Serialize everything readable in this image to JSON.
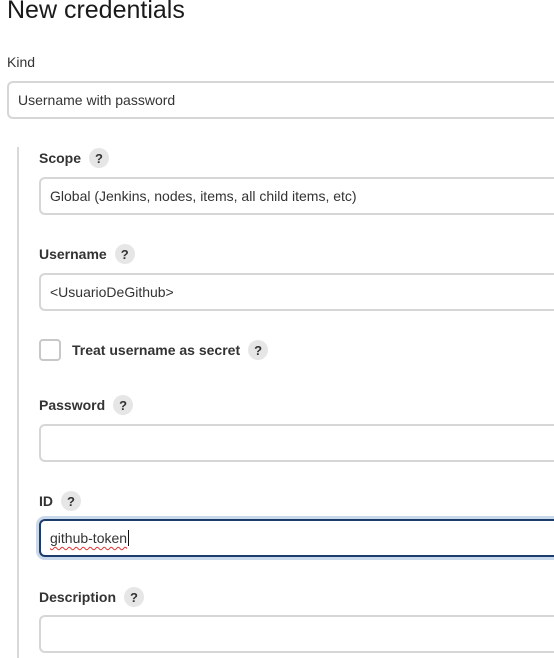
{
  "page": {
    "title": "New credentials"
  },
  "kind": {
    "label": "Kind",
    "value": "Username with password"
  },
  "scope": {
    "label": "Scope",
    "help": "?",
    "value": "Global (Jenkins, nodes, items, all child items, etc)"
  },
  "username": {
    "label": "Username",
    "help": "?",
    "value": "<UsuarioDeGithub>"
  },
  "treat_secret": {
    "label": "Treat username as secret",
    "help": "?",
    "checked": false
  },
  "password": {
    "label": "Password",
    "help": "?",
    "value": ""
  },
  "id": {
    "label": "ID",
    "help": "?",
    "value": "github-token"
  },
  "description": {
    "label": "Description",
    "help": "?",
    "value": ""
  }
}
